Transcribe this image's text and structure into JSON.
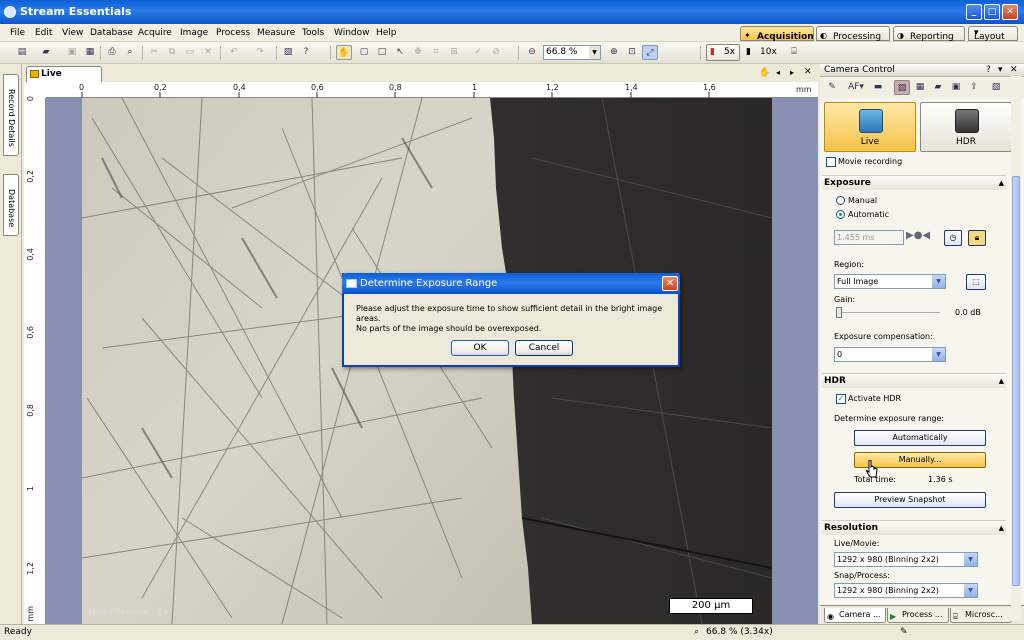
{
  "window": {
    "title": "Stream Essentials"
  },
  "menu": [
    "File",
    "Edit",
    "View",
    "Database",
    "Acquire",
    "Image",
    "Process",
    "Measure",
    "Tools",
    "Window",
    "Help"
  ],
  "perspectives": {
    "acquisition": "Acquisition",
    "processing": "Processing",
    "reporting": "Reporting",
    "layout": "Layout"
  },
  "toolbar": {
    "zoom_value": "66.8 %",
    "mag_5x": "5x",
    "mag_10x": "10x"
  },
  "side_tabs": {
    "record_details": "Record Details",
    "database": "Database"
  },
  "document": {
    "tab_label": "Live (active)",
    "ruler_unit": "mm",
    "h_ticks": [
      "0",
      "0,2",
      "0,4",
      "0,6",
      "0,8",
      "1",
      "1,2",
      "1,4",
      "1,6"
    ],
    "v_ticks": [
      "0",
      "0,2",
      "0,4",
      "0,6",
      "0,8",
      "1",
      "1,2"
    ],
    "v_unit": "mm",
    "scale_bar": "200 µm",
    "magnification": "Magnification : 5x"
  },
  "dialog": {
    "title": "Determine Exposure Range",
    "line1": "Please adjust the exposure time to show sufficient detail in the bright image areas.",
    "line2": "No parts of the image should be overexposed.",
    "ok": "OK",
    "cancel": "Cancel"
  },
  "camera_control": {
    "title": "Camera Control",
    "live_label": "Live",
    "hdr_label": "HDR",
    "movie_recording": "Movie recording",
    "exposure": {
      "header": "Exposure",
      "manual": "Manual",
      "automatic": "Automatic",
      "time": "1.455 ms",
      "region_label": "Region:",
      "region_value": "Full Image",
      "gain_label": "Gain:",
      "gain_value": "0.0 dB",
      "gain_level": 0,
      "comp_label": "Exposure compensation:",
      "comp_value": "0"
    },
    "hdr": {
      "header": "HDR",
      "activate": "Activate HDR",
      "determine_label": "Determine exposure range:",
      "automatically": "Automatically",
      "manually": "Manually...",
      "total_time_label": "Total time:",
      "total_time_value": "1.36 s",
      "preview": "Preview Snapshot"
    },
    "resolution": {
      "header": "Resolution",
      "live_label": "Live/Movie:",
      "live_value": "1292 x 980 (Binning 2x2)",
      "snap_label": "Snap/Process:",
      "snap_value": "1292 x 980 (Binning 2x2)"
    },
    "bottom_tabs": [
      "Camera ...",
      "Process ...",
      "Microsc..."
    ]
  },
  "status": {
    "left": "Ready",
    "zoom": "66.8 % (3.34x)"
  }
}
